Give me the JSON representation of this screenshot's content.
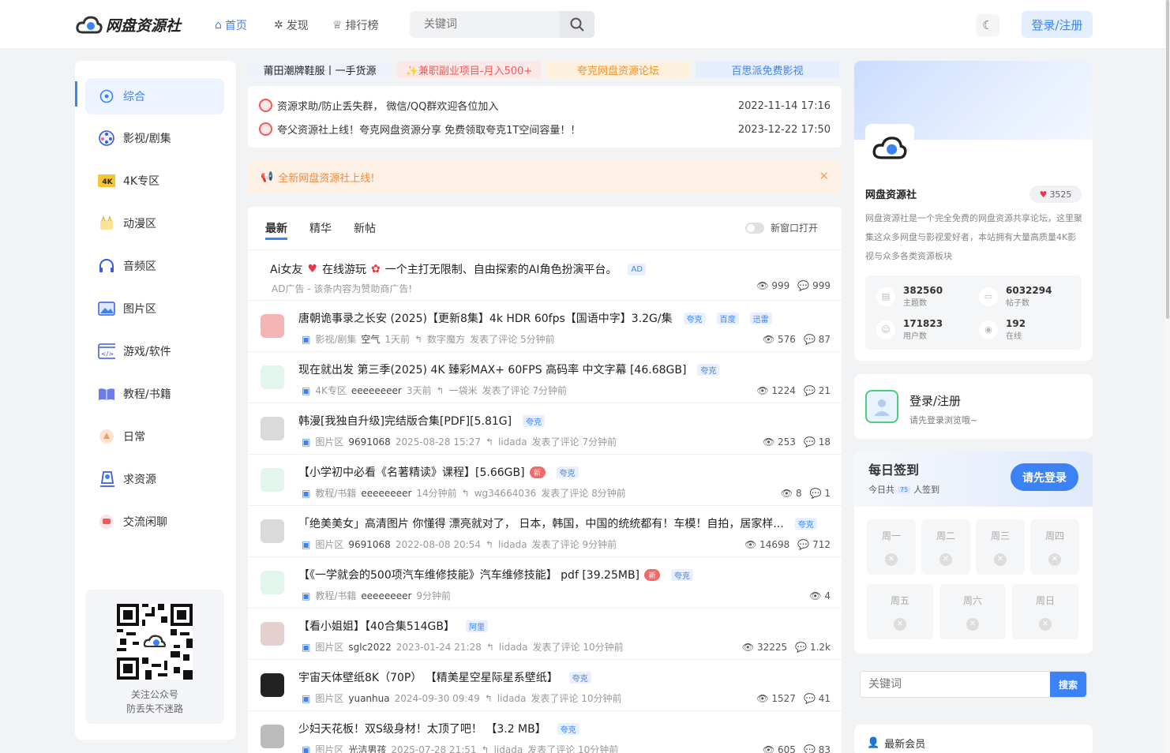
{
  "header": {
    "logo_text": "网盘资源社",
    "nav": [
      {
        "label": "首页",
        "icon": "home-icon"
      },
      {
        "label": "发现",
        "icon": "compass-icon"
      },
      {
        "label": "排行榜",
        "icon": "trophy-icon"
      }
    ],
    "search_placeholder": "关键词",
    "login_label": "登录/注册"
  },
  "sidebar": {
    "items": [
      {
        "label": "综合",
        "icon": "compass-icon"
      },
      {
        "label": "影视/剧集",
        "icon": "film-reel-icon"
      },
      {
        "label": "4K专区",
        "icon": "4k-badge-icon"
      },
      {
        "label": "动漫区",
        "icon": "anime-icon"
      },
      {
        "label": "音频区",
        "icon": "headphones-icon"
      },
      {
        "label": "图片区",
        "icon": "image-icon"
      },
      {
        "label": "游戏/软件",
        "icon": "code-window-icon"
      },
      {
        "label": "教程/书籍",
        "icon": "book-icon"
      },
      {
        "label": "日常",
        "icon": "daily-icon"
      },
      {
        "label": "求资源",
        "icon": "request-icon"
      },
      {
        "label": "交流闲聊",
        "icon": "chat-icon"
      }
    ],
    "qr_line1": "关注公众号",
    "qr_line2": "防丢失不迷路"
  },
  "ads": [
    "莆田潮牌鞋服丨一手货源",
    "✨兼职副业项目-月入500+",
    "夸克网盘资源论坛",
    "百思派免费影视"
  ],
  "notices": [
    {
      "text": "资源求助/防止丢失群， 微信/QQ群欢迎各位加入",
      "date": "2022-11-14 17:16"
    },
    {
      "text": "夸父资源社上线！夸克网盘资源分享 免费领取夸克1T空间容量！！",
      "date": "2023-12-22 17:50"
    }
  ],
  "announcement": "全新网盘资源社上线!",
  "tabs": [
    "最新",
    "精华",
    "新帖"
  ],
  "toggle_label": "新窗口打开",
  "ad_row": {
    "title_a": "Ai女友",
    "title_b": "在线游玩",
    "title_c": "一个主打无限制、自由探索的AI角色扮演平台。",
    "tag": "AD",
    "meta": "AD广告 - 该条内容为赞助商广告!",
    "views": "999",
    "comments": "999"
  },
  "posts": [
    {
      "title": "唐朝诡事录之长安 (2025)【更新8集】4k HDR 60fps【国语中字】3.2G/集",
      "tags": [
        "夸克",
        "百度",
        "迅雷"
      ],
      "is_new": false,
      "category": "影视/剧集",
      "author": "空气",
      "time": "1天前",
      "replier": "数字魔方",
      "reply_text": "发表了评论 5分钟前",
      "views": "576",
      "comments": "87"
    },
    {
      "title": "现在就出发 第三季(2025) 4K 臻彩MAX+ 60FPS 高码率 中文字幕 [46.68GB]",
      "tags": [
        "夸克"
      ],
      "is_new": false,
      "category": "4K专区",
      "author": "eeeeeeeer",
      "time": "3天前",
      "replier": "一袋米",
      "reply_text": "发表了评论 7分钟前",
      "views": "1224",
      "comments": "21"
    },
    {
      "title": "韩漫[我独自升级]完结版合集[PDF][5.81G]",
      "tags": [
        "夸克"
      ],
      "is_new": false,
      "category": "图片区",
      "author": "9691068",
      "time": "2025-08-28 15:27",
      "replier": "lidada",
      "reply_text": "发表了评论 7分钟前",
      "views": "253",
      "comments": "18"
    },
    {
      "title": "【小学初中必看《名著精读》课程】[5.66GB]",
      "tags": [
        "夸克"
      ],
      "is_new": true,
      "category": "教程/书籍",
      "author": "eeeeeeeer",
      "time": "14分钟前",
      "replier": "wg34664036",
      "reply_text": "发表了评论 8分钟前",
      "views": "8",
      "comments": "1"
    },
    {
      "title": "「绝美美女」高清图片 你懂得 漂亮就对了， 日本，韩国，中国的统统都有！车模！自拍，居家样...",
      "tags": [
        "夸克"
      ],
      "is_new": false,
      "category": "图片区",
      "author": "9691068",
      "time": "2022-08-08 20:54",
      "replier": "lidada",
      "reply_text": "发表了评论 9分钟前",
      "views": "14698",
      "comments": "712"
    },
    {
      "title": "【《一学就会的500项汽车维修技能》汽车维修技能】 pdf [39.25MB]",
      "tags": [
        "夸克"
      ],
      "is_new": true,
      "category": "教程/书籍",
      "author": "eeeeeeeer",
      "time": "9分钟前",
      "replier": "",
      "reply_text": "",
      "views": "4",
      "comments": ""
    },
    {
      "title": "【看小姐姐】【40合集514GB】",
      "tags": [
        "阿里"
      ],
      "is_new": false,
      "category": "图片区",
      "author": "sglc2022",
      "time": "2023-01-24 21:28",
      "replier": "lidada",
      "reply_text": "发表了评论 10分钟前",
      "views": "32225",
      "comments": "1.2k"
    },
    {
      "title": "宇宙天体壁纸8K（70P） 【精美星空星际星系壁纸】",
      "tags": [
        "夸克"
      ],
      "is_new": false,
      "category": "图片区",
      "author": "yuanhua",
      "time": "2024-09-30 09:49",
      "replier": "lidada",
      "reply_text": "发表了评论 10分钟前",
      "views": "1527",
      "comments": "41"
    },
    {
      "title": "少妇天花板！双S级身材！太顶了吧！ 【3.2 MB】",
      "tags": [
        "夸克"
      ],
      "is_new": false,
      "category": "图片区",
      "author": "光洁男孩",
      "time": "2025-07-28 21:51",
      "replier": "lidada",
      "reply_text": "发表了评论 10分钟前",
      "views": "605",
      "comments": "83"
    }
  ],
  "new_tag": "新",
  "profile": {
    "name": "网盘资源社",
    "likes": "3525",
    "desc": "网盘资源社是一个完全免费的网盘资源共享论坛，这里聚集这众多网盘与影视爱好者，本站拥有大量高质量4K影视与众多各类资源板块",
    "stats": [
      {
        "value": "382560",
        "label": "主题数",
        "icon": "doc-icon"
      },
      {
        "value": "6032294",
        "label": "帖子数",
        "icon": "message-icon"
      },
      {
        "value": "171823",
        "label": "用户数",
        "icon": "users-icon"
      },
      {
        "value": "192",
        "label": "在线",
        "icon": "signal-icon"
      }
    ]
  },
  "login_card": {
    "title": "登录/注册",
    "sub": "请先登录浏览哦~"
  },
  "checkin": {
    "title": "每日签到",
    "sub_a": "今日共",
    "count": "75",
    "sub_b": "人签到",
    "button": "请先登录",
    "days": [
      "周一",
      "周二",
      "周三",
      "周四",
      "周五",
      "周六",
      "周日"
    ]
  },
  "right_search": {
    "placeholder": "关键词",
    "button": "搜索"
  },
  "new_members": "最新会员"
}
